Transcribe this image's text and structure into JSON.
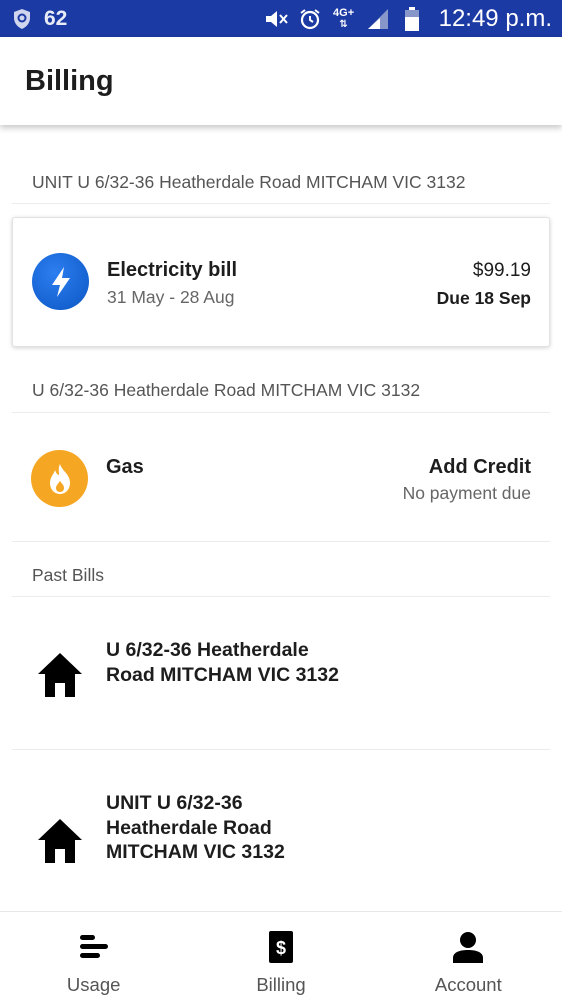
{
  "status_bar": {
    "battery_level": "62",
    "network": "4G+",
    "time": "12:49 p.m."
  },
  "header": {
    "title": "Billing"
  },
  "accounts": [
    {
      "address": "UNIT U 6/32-36 Heatherdale Road MITCHAM VIC 3132",
      "bill": {
        "type": "Electricity bill",
        "period": "31 May - 28 Aug",
        "amount": "$99.19",
        "due": "Due 18 Sep",
        "icon": "lightning-bolt-icon",
        "icon_color": "#0f5fd6"
      }
    },
    {
      "address": "U 6/32-36 Heatherdale Road MITCHAM VIC 3132",
      "bill": {
        "type": "Gas",
        "action": "Add Credit",
        "status": "No payment due",
        "icon": "flame-icon",
        "icon_color": "#f5a623"
      }
    }
  ],
  "past_bills": {
    "label": "Past Bills",
    "items": [
      {
        "address_lines": [
          "U 6/32-36 Heatherdale",
          "Road MITCHAM VIC 3132"
        ],
        "icon": "house-icon"
      },
      {
        "address_lines": [
          "UNIT U 6/32-36",
          "Heatherdale Road",
          "MITCHAM VIC 3132"
        ],
        "icon": "house-icon"
      }
    ]
  },
  "bottom_nav": {
    "items": [
      {
        "label": "Usage",
        "icon": "usage-bars-icon"
      },
      {
        "label": "Billing",
        "icon": "dollar-document-icon",
        "active": true
      },
      {
        "label": "Account",
        "icon": "person-icon"
      }
    ]
  },
  "colors": {
    "status_bar": "#1c3aa3",
    "electricity_icon": "#0f5fd6",
    "gas_icon": "#f5a623"
  }
}
